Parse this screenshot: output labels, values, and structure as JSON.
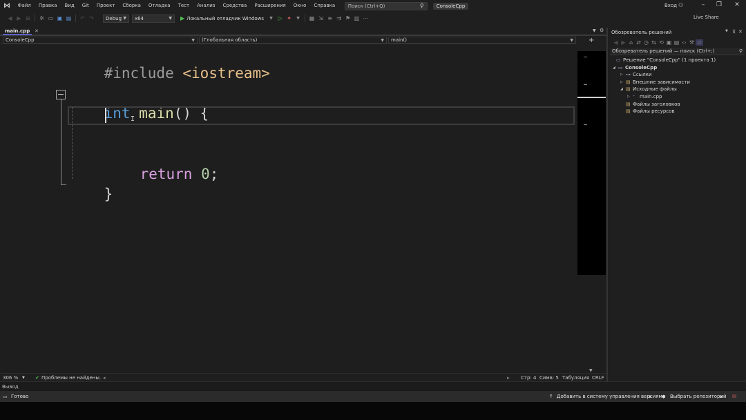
{
  "menu": {
    "items": [
      "Файл",
      "Правка",
      "Вид",
      "Git",
      "Проект",
      "Сборка",
      "Отладка",
      "Тест",
      "Анализ",
      "Средства",
      "Расширения",
      "Окно",
      "Справка"
    ],
    "search_placeholder": "Поиск (Ctrl+Q)",
    "solution_name": "ConsoleCpp",
    "login": "Вход"
  },
  "toolbar": {
    "configuration": "Debug",
    "platform": "x64",
    "run_target": "Локальный отладчик Windows",
    "live_share": "Live Share"
  },
  "editor": {
    "tab_label": "main.cpp",
    "nav_project": "ConsoleCpp",
    "nav_scope": "(Глобальная область)",
    "nav_member": "main()",
    "code": {
      "line1_directive": "#include",
      "line1_header": "<iostream>",
      "line2_type": "int",
      "line2_name": "main",
      "line2_rest": "() {",
      "line4_keyword": "return",
      "line4_value": "0",
      "line4_end": ";",
      "line5_brace": "}"
    }
  },
  "editor_status": {
    "zoom": "306 %",
    "problems": "Проблемы не найдены.",
    "line": "Стр: 4",
    "column": "Симв: 5",
    "indent": "Табуляция",
    "line_ending": "CRLF"
  },
  "output": {
    "label": "Вывод"
  },
  "statusbar": {
    "ready": "Готово",
    "add_to_vcs": "Добавить в систему управления версиями",
    "select_repo": "Выбрать репозиторий"
  },
  "solution_explorer": {
    "title": "Обозреватель решений",
    "search_placeholder": "Обозреватель решений — поиск (Ctrl+;)",
    "solution_node": "Решение \"ConsoleCpp\" (1 проекта 1)",
    "project_node": "ConsoleCpp",
    "references": "Ссылки",
    "external_deps": "Внешние зависимости",
    "source_files": "Исходные файлы",
    "main_file": "main.cpp",
    "header_files": "Файлы заголовков",
    "resource_files": "Файлы ресурсов"
  },
  "colors": {
    "accent": "#5b5fc7",
    "keyword": "#569cd6",
    "function": "#dcdcaa",
    "control_keyword": "#d8a0df",
    "include_path": "#e8c08a",
    "number": "#b5cea8",
    "ok_green": "#4ec24e"
  }
}
